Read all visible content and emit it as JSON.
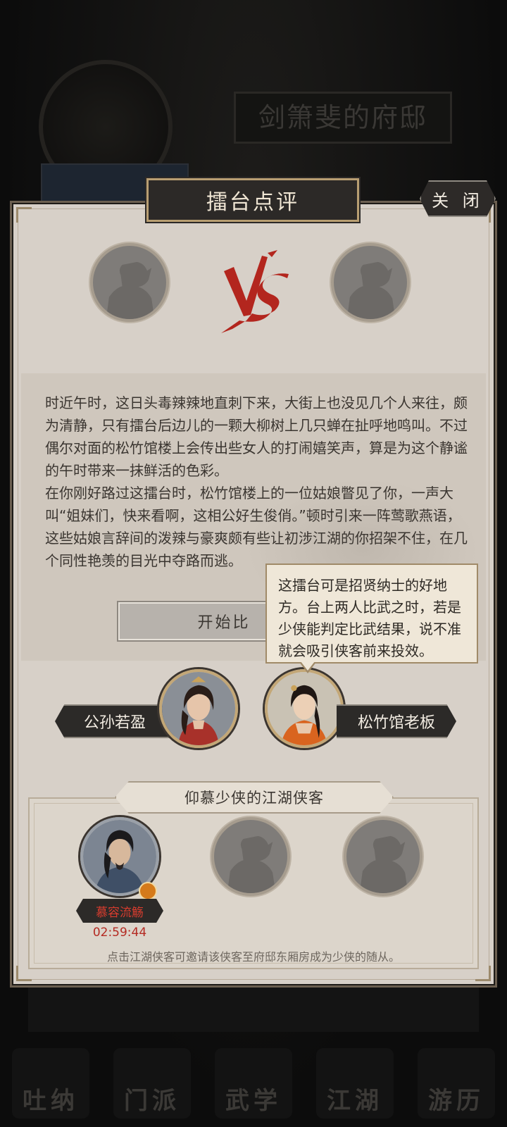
{
  "background": {
    "house_title": "剑箫斐的府邸",
    "stats_text": "",
    "nav_items": [
      {
        "label": "吐纳"
      },
      {
        "label": "门派"
      },
      {
        "label": "武学"
      },
      {
        "label": "江湖"
      },
      {
        "label": "游历"
      }
    ]
  },
  "dialog": {
    "title": "擂台点评",
    "close_label": "关 闭",
    "story_paragraphs": [
      "时近午时，这日头毒辣辣地直刺下来，大街上也没见几个人来往，颇为清静，只有擂台后边儿的一颗大柳树上几只蝉在扯呼地鸣叫。不过偶尔对面的松竹馆楼上会传出些女人的打闹嬉笑声，算是为这个静谧的午时带来一抹鲜活的色彩。",
      "在你刚好路过这擂台时，松竹馆楼上的一位姑娘瞥见了你，一声大叫“姐妹们，快来看啊，这相公好生俊俏。”顿时引来一阵莺歌燕语，这些姑娘言辞间的泼辣与豪爽颇有些让初涉江湖的你招架不住，在几个同性艳羡的目光中夺路而逃。"
    ],
    "start_button_label": "开始比",
    "tooltip_text": "这擂台可是招贤纳士的好地方。台上两人比武之时，若是少侠能判定比武结果，说不准就会吸引侠客前来投效。",
    "fighters": [
      {
        "name": "公孙若盈"
      },
      {
        "name": "松竹馆老板"
      }
    ],
    "followers": {
      "header": "仰慕少侠的江湖侠客",
      "members": [
        {
          "name": "慕容流觞",
          "timer": "02:59:44"
        }
      ],
      "hint": "点击江湖侠客可邀请该侠客至府邸东厢房成为少侠的随从。"
    }
  },
  "colors": {
    "accent_gold": "#b89e72",
    "vs_red": "#b3261e",
    "timer_red": "#b42a22"
  }
}
